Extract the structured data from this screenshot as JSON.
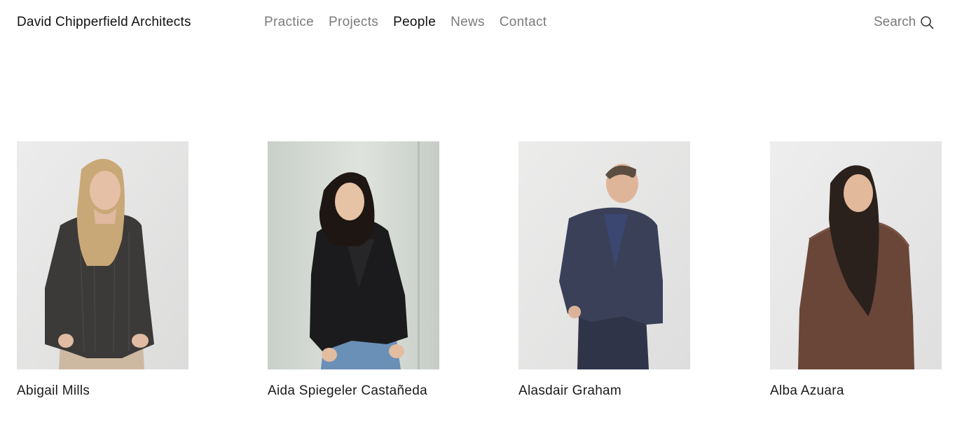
{
  "header": {
    "brand": "David Chipperfield Architects",
    "nav": [
      {
        "label": "Practice",
        "active": false
      },
      {
        "label": "Projects",
        "active": false
      },
      {
        "label": "People",
        "active": true
      },
      {
        "label": "News",
        "active": false
      },
      {
        "label": "Contact",
        "active": false
      }
    ],
    "search_label": "Search",
    "search_icon": "search-icon"
  },
  "people": [
    {
      "name": "Abigail Mills"
    },
    {
      "name": "Aida Spiegeler Castañeda"
    },
    {
      "name": "Alasdair Graham"
    },
    {
      "name": "Alba Azuara"
    }
  ]
}
